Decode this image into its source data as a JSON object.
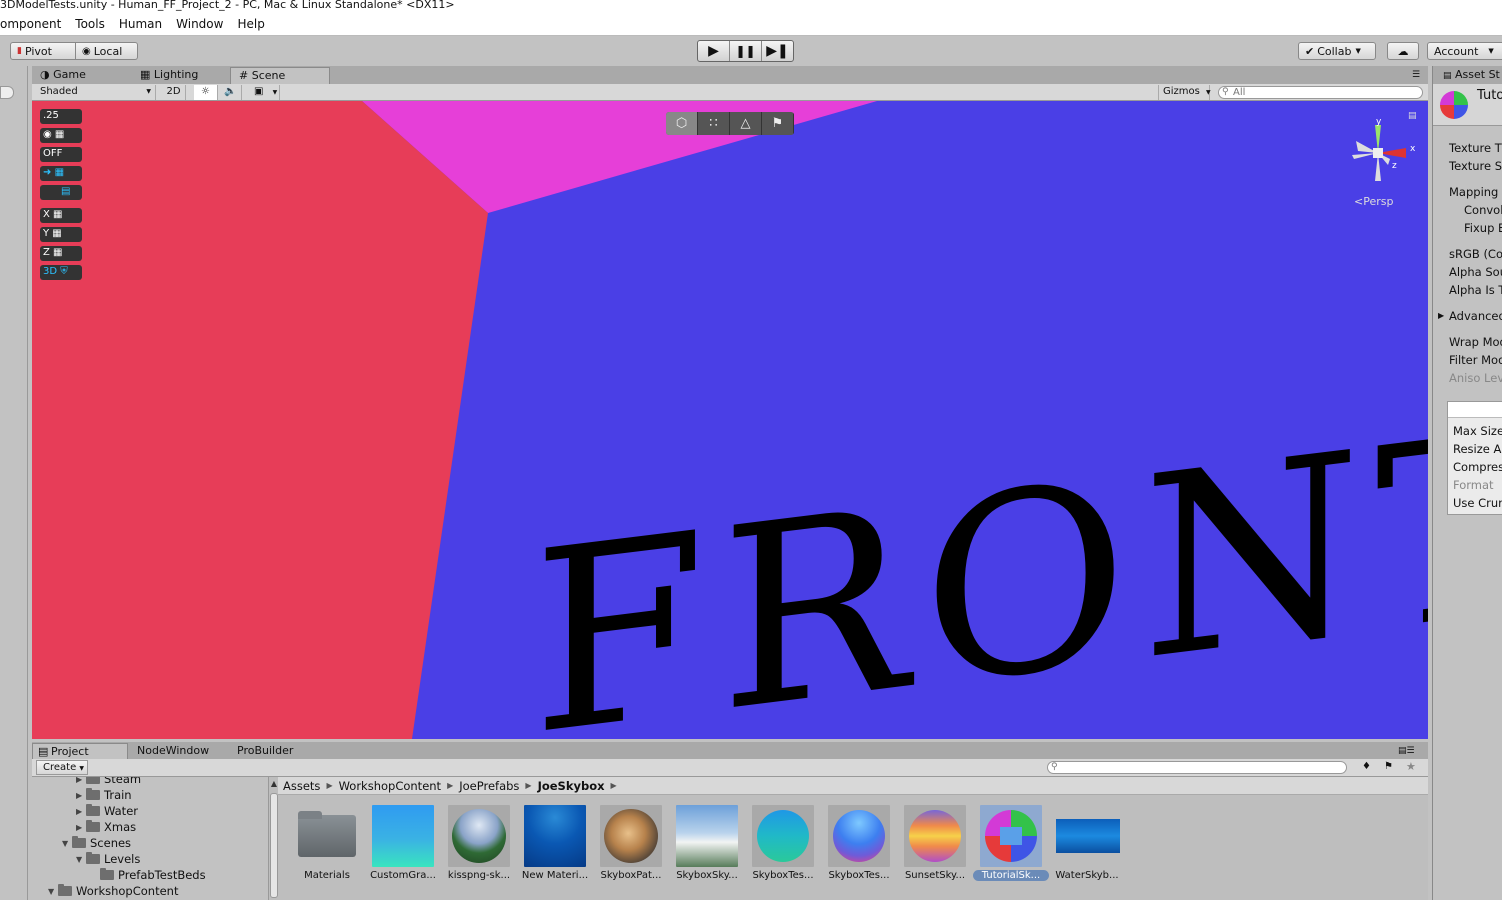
{
  "window": {
    "title": "3DModelTests.unity - Human_FF_Project_2 - PC, Mac & Linux Standalone* <DX11>"
  },
  "menu": [
    "omponent",
    "Tools",
    "Human",
    "Window",
    "Help"
  ],
  "toolbar": {
    "pivot": "Pivot",
    "local": "Local",
    "collab": "Collab",
    "account": "Account",
    "play_icon": "play-icon",
    "pause_icon": "pause-icon",
    "step_icon": "step-icon"
  },
  "scene_tabs": {
    "game": "Game",
    "lighting": "Lighting",
    "scene": "Scene"
  },
  "scene_toolbar": {
    "shading": "Shaded",
    "mode_2d": "2D",
    "gizmos": "Gizmos",
    "search_placeholder": "All"
  },
  "viewport": {
    "colors": {
      "left_wall": "#e73d58",
      "ceiling": "#e63fd8",
      "front_wall": "#4a3fe6",
      "text": "#000000"
    },
    "front_text": "FRONT",
    "persp_label": "Persp",
    "axis_labels": [
      "y",
      "x",
      "z"
    ],
    "snap_tools": [
      ".25",
      "",
      "OFF",
      "",
      "",
      "X",
      "Y",
      "Z",
      "3D"
    ]
  },
  "bottom_tabs": {
    "project": "Project",
    "node_window": "NodeWindow",
    "probuilder": "ProBuilder"
  },
  "project": {
    "create": "Create",
    "tree": [
      {
        "name": "Steam",
        "depth": 2,
        "expanded": false
      },
      {
        "name": "Train",
        "depth": 2,
        "expanded": false
      },
      {
        "name": "Water",
        "depth": 2,
        "expanded": false
      },
      {
        "name": "Xmas",
        "depth": 2,
        "expanded": false
      },
      {
        "name": "Scenes",
        "depth": 1,
        "expanded": true
      },
      {
        "name": "Levels",
        "depth": 2,
        "expanded": true
      },
      {
        "name": "PrefabTestBeds",
        "depth": 3,
        "expanded": false
      },
      {
        "name": "WorkshopContent",
        "depth": 0,
        "expanded": true
      }
    ],
    "breadcrumb": [
      "Assets",
      "WorkshopContent",
      "JoePrefabs",
      "JoeSkybox"
    ],
    "assets": [
      {
        "label": "Materials",
        "kind": "folder"
      },
      {
        "label": "CustomGra...",
        "kind": "gradient"
      },
      {
        "label": "kisspng-sk...",
        "kind": "globe"
      },
      {
        "label": "New Materi...",
        "kind": "water"
      },
      {
        "label": "SkyboxPat...",
        "kind": "pattern"
      },
      {
        "label": "SkyboxSky...",
        "kind": "sky"
      },
      {
        "label": "SkyboxTes...",
        "kind": "sphere-teal"
      },
      {
        "label": "SkyboxTes...",
        "kind": "sphere-blue"
      },
      {
        "label": "SunsetSky...",
        "kind": "sphere-sunset"
      },
      {
        "label": "TutorialSk...",
        "kind": "sphere-tutorial",
        "selected": true
      },
      {
        "label": "WaterSkyb...",
        "kind": "water-strip"
      }
    ]
  },
  "inspector": {
    "tab": "Asset St",
    "asset_name": "Tuto",
    "rows": [
      {
        "label": "Texture T",
        "style": "normal"
      },
      {
        "label": "Texture S",
        "style": "normal"
      },
      {
        "label": "Mapping",
        "style": "normal"
      },
      {
        "label": "Convol",
        "style": "sub"
      },
      {
        "label": "Fixup E",
        "style": "sub"
      },
      {
        "label": "sRGB (Co",
        "style": "normal"
      },
      {
        "label": "Alpha Sou",
        "style": "normal"
      },
      {
        "label": "Alpha Is T",
        "style": "normal"
      },
      {
        "label": "Advanced",
        "style": "normal"
      },
      {
        "label": "Wrap Mod",
        "style": "normal"
      },
      {
        "label": "Filter Mod",
        "style": "normal"
      },
      {
        "label": "Aniso Lev",
        "style": "dim"
      }
    ],
    "box_rows": [
      {
        "label": "Max Size",
        "style": "normal"
      },
      {
        "label": "Resize A",
        "style": "normal"
      },
      {
        "label": "Compres",
        "style": "normal"
      },
      {
        "label": "Format",
        "style": "dim"
      },
      {
        "label": "Use Crur",
        "style": "normal"
      }
    ]
  }
}
